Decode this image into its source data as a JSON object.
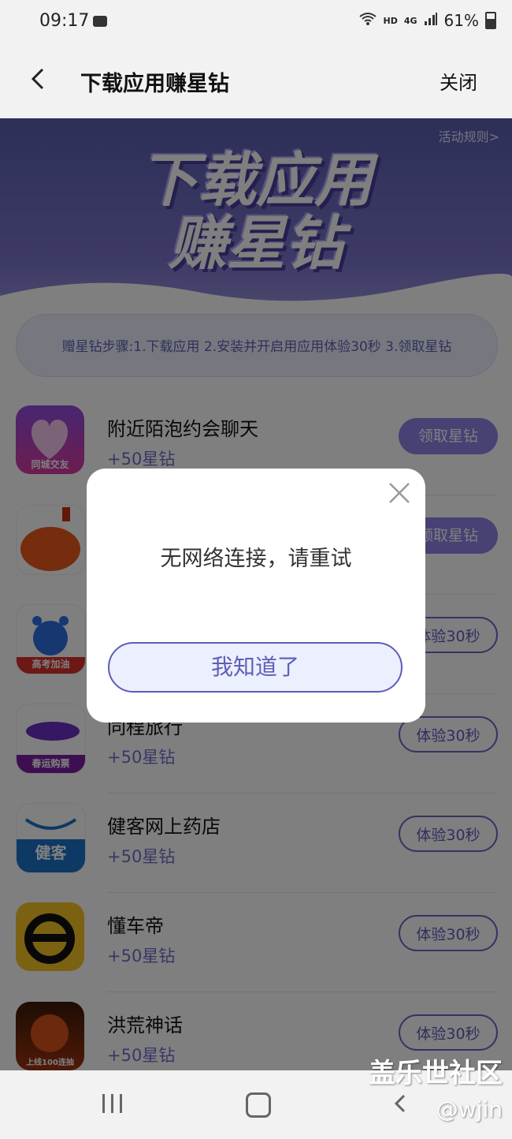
{
  "status_bar": {
    "time": "09:17",
    "network": "HD",
    "signal": "4G",
    "battery": "61%"
  },
  "header": {
    "title": "下载应用赚星钻",
    "close_label": "关闭"
  },
  "banner": {
    "line1": "下载应用",
    "line2": "赚星钻",
    "rules_link": "活动规则>"
  },
  "steps": "赠星钻步骤:1.下载应用 2.安装并开启用应用体验30秒 3.领取星钻",
  "apps": [
    {
      "name": "附近陌泡约会聊天",
      "reward": "+50星钻",
      "button": "领取星钻",
      "icon_label": "同城交友"
    },
    {
      "name": "",
      "reward": "",
      "button": "领取星钻",
      "icon_label": ""
    },
    {
      "name": "",
      "reward": "",
      "button": "体验30秒",
      "icon_label": "高考加油"
    },
    {
      "name": "同程旅行",
      "reward": "+50星钻",
      "button": "体验30秒",
      "icon_label": "春运购票"
    },
    {
      "name": "健客网上药店",
      "reward": "+50星钻",
      "button": "体验30秒",
      "icon_label": "健客"
    },
    {
      "name": "懂车帝",
      "reward": "+50星钻",
      "button": "体验30秒",
      "icon_label": ""
    },
    {
      "name": "洪荒神话",
      "reward": "+50星钻",
      "button": "体验30秒",
      "icon_label": "上线100连抽"
    }
  ],
  "dialog": {
    "message": "无网络连接，请重试",
    "button": "我知道了"
  },
  "watermark": {
    "line1": "盖乐世社区",
    "line2": "@wjin"
  },
  "colors": {
    "accent": "#6d67c8",
    "banner": "#5a5fb0",
    "reward": "#6f6fd0"
  }
}
